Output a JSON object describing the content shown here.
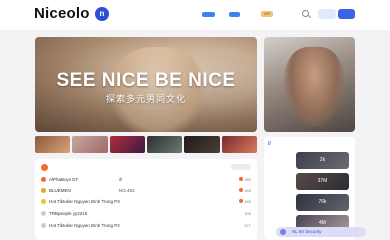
{
  "header": {
    "brand": "Niceolo",
    "logo_glyph": "n",
    "badge": "VIP",
    "search_icon": "search-icon"
  },
  "hero": {
    "title": "SEE NICE BE NICE",
    "subtitle": "探索多元男同文化"
  },
  "feed": {
    "rows": [
      {
        "name": "AlPhaBoys DT",
        "mid": "ill",
        "count": "380",
        "color": "#f06b2d"
      },
      {
        "name": "BLUEMEN",
        "mid": "NO.483",
        "count": "486",
        "color": "#f0a02d"
      },
      {
        "name": "Hot Tiktoker Nguyen Dinh Trung P3",
        "mid": "",
        "count": "486",
        "color": "#f0c02d"
      },
      {
        "name": "TRBpeople yy2210",
        "mid": "",
        "count": "306",
        "color": "#aaaaaa"
      },
      {
        "name": "Hot Tiktoker Nguyen Dinh Trung P2",
        "mid": "",
        "count": "477",
        "color": "#aaaaaa"
      }
    ]
  },
  "sidebar": {
    "mark": "//",
    "tiles": [
      "2k",
      "37M",
      "76k",
      "4M"
    ]
  },
  "floating": {
    "label": "NL 50 Security"
  }
}
